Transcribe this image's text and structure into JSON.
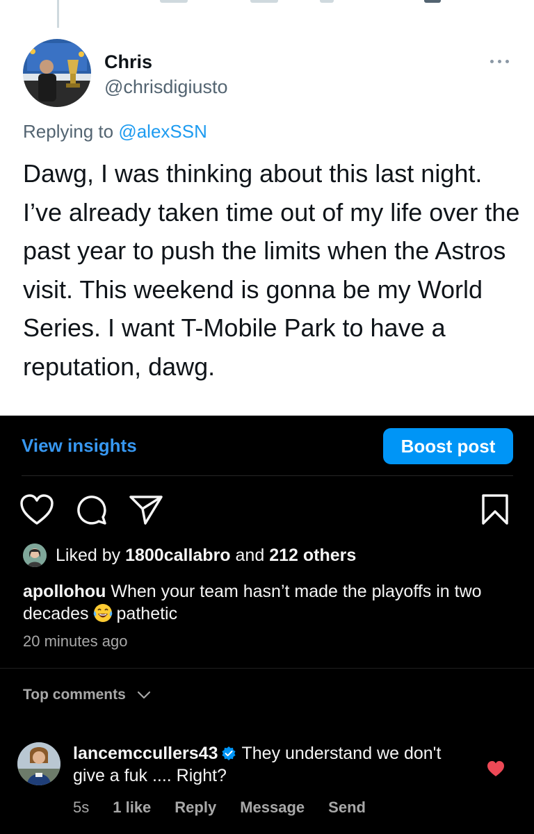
{
  "tweet": {
    "author_name": "Chris",
    "author_handle": "@chrisdigiusto",
    "replying_prefix": "Replying to",
    "replying_to_handle": "@alexSSN",
    "text": "Dawg, I was thinking about this last night. I’ve already taken time out of my life over the past year to push the limits when the Astros visit. This weekend is gonna be my World Series. I want T-Mobile Park to have a reputation, dawg.",
    "more_icon": "more-horizontal-icon"
  },
  "post": {
    "view_insights_label": "View insights",
    "boost_label": "Boost post",
    "actions": {
      "like_icon": "heart-outline-icon",
      "comment_icon": "comment-bubble-icon",
      "share_icon": "paper-plane-icon",
      "save_icon": "bookmark-icon"
    },
    "likes": {
      "prefix": "Liked by",
      "user": "1800callabro",
      "connector": "and",
      "others": "212 others"
    },
    "caption": {
      "username": "apollohou",
      "text_before_emoji": "When your team hasn’t made the playoffs in two decades",
      "emoji": "face-with-tears-of-joy",
      "text_after_emoji": "pathetic"
    },
    "timestamp": "20 minutes ago"
  },
  "comments": {
    "header": "Top comments",
    "items": [
      {
        "username": "lancemccullers43",
        "verified": true,
        "text": "They understand we don't give a fuk .... Right?",
        "age": "5s",
        "likes_label": "1 like",
        "reply_label": "Reply",
        "message_label": "Message",
        "send_label": "Send",
        "liked": true
      }
    ]
  },
  "colors": {
    "accent_blue": "#0095f6",
    "link_blue": "#3797f0",
    "twitter_blue": "#1d9bf0",
    "like_red": "#ed4956"
  }
}
